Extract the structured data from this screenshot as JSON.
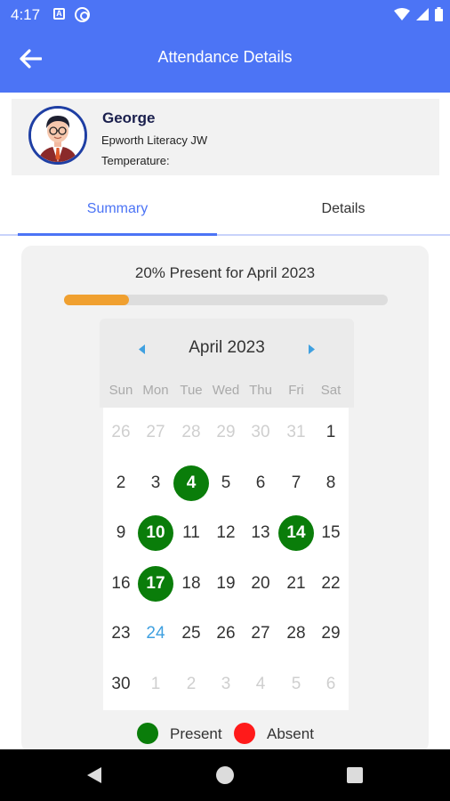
{
  "status_bar": {
    "time": "4:17",
    "icons": [
      "notification-a-icon",
      "sync-icon",
      "wifi-icon",
      "signal-icon",
      "battery-icon"
    ]
  },
  "app_bar": {
    "title": "Attendance Details",
    "back_icon": "arrow-left-icon",
    "color": "#4c74f5"
  },
  "profile": {
    "name": "George",
    "organization": "Epworth Literacy JW",
    "temperature_label": "Temperature:"
  },
  "tabs": [
    {
      "label": "Summary",
      "active": true
    },
    {
      "label": "Details",
      "active": false
    }
  ],
  "summary": {
    "text": "20% Present for April 2023",
    "progress": 0.2,
    "progress_color": "#f0a030"
  },
  "calendar": {
    "month_label": "April 2023",
    "weekdays": [
      "Sun",
      "Mon",
      "Tue",
      "Wed",
      "Thu",
      "Fri",
      "Sat"
    ],
    "weeks": [
      [
        {
          "d": "26",
          "muted": true
        },
        {
          "d": "27",
          "muted": true
        },
        {
          "d": "28",
          "muted": true
        },
        {
          "d": "29",
          "muted": true
        },
        {
          "d": "30",
          "muted": true
        },
        {
          "d": "31",
          "muted": true
        },
        {
          "d": "1"
        }
      ],
      [
        {
          "d": "2"
        },
        {
          "d": "3"
        },
        {
          "d": "4",
          "status": "present"
        },
        {
          "d": "5"
        },
        {
          "d": "6"
        },
        {
          "d": "7"
        },
        {
          "d": "8"
        }
      ],
      [
        {
          "d": "9"
        },
        {
          "d": "10",
          "status": "present"
        },
        {
          "d": "11"
        },
        {
          "d": "12"
        },
        {
          "d": "13"
        },
        {
          "d": "14",
          "status": "present"
        },
        {
          "d": "15"
        }
      ],
      [
        {
          "d": "16"
        },
        {
          "d": "17",
          "status": "present"
        },
        {
          "d": "18"
        },
        {
          "d": "19"
        },
        {
          "d": "20"
        },
        {
          "d": "21"
        },
        {
          "d": "22"
        }
      ],
      [
        {
          "d": "23"
        },
        {
          "d": "24",
          "today": true
        },
        {
          "d": "25"
        },
        {
          "d": "26"
        },
        {
          "d": "27"
        },
        {
          "d": "28"
        },
        {
          "d": "29"
        }
      ],
      [
        {
          "d": "30"
        },
        {
          "d": "1",
          "muted": true
        },
        {
          "d": "2",
          "muted": true
        },
        {
          "d": "3",
          "muted": true
        },
        {
          "d": "4",
          "muted": true
        },
        {
          "d": "5",
          "muted": true
        },
        {
          "d": "6",
          "muted": true
        }
      ]
    ],
    "present_color": "#0a7d0a",
    "today_color": "#3fa0e0"
  },
  "legend": [
    {
      "label": "Present",
      "color": "#0a7d0a"
    },
    {
      "label": "Absent",
      "color": "#ff1a1a"
    }
  ],
  "nav_bar": {
    "icons": [
      "back-triangle-icon",
      "home-circle-icon",
      "recents-square-icon"
    ]
  }
}
